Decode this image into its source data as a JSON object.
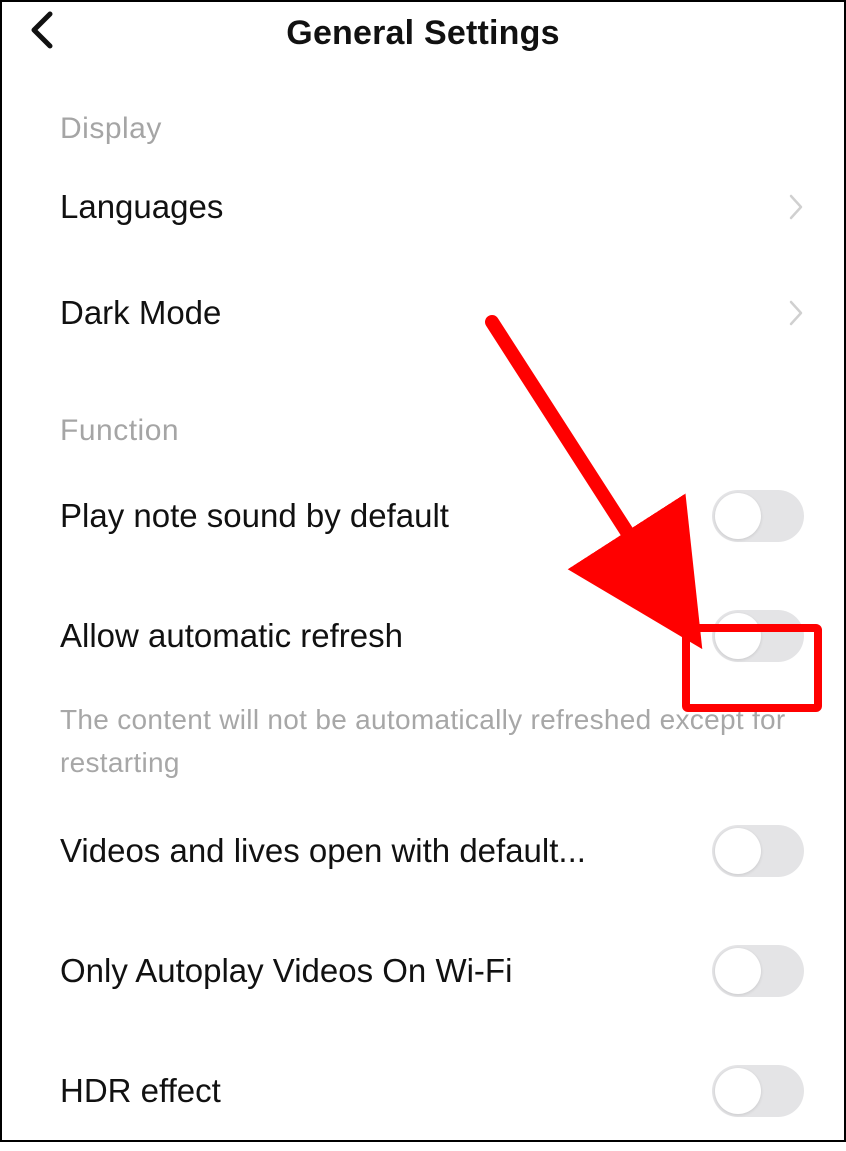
{
  "header": {
    "title": "General Settings"
  },
  "sections": {
    "display": {
      "label": "Display",
      "languages": "Languages",
      "dark_mode": "Dark Mode"
    },
    "function": {
      "label": "Function",
      "play_note_sound": "Play note sound by default",
      "allow_auto_refresh": "Allow automatic refresh",
      "auto_refresh_desc": "The content will not be automatically refreshed except for restarting",
      "videos_default": "Videos and lives open with default...",
      "only_wifi": "Only Autoplay Videos On Wi-Fi",
      "hdr": "HDR effect"
    }
  },
  "toggles": {
    "play_note_sound": false,
    "allow_auto_refresh": false,
    "videos_default": false,
    "only_wifi": false,
    "hdr": false
  },
  "annotation": {
    "arrow_color": "#ff0000",
    "highlight_color": "#ff0000"
  }
}
